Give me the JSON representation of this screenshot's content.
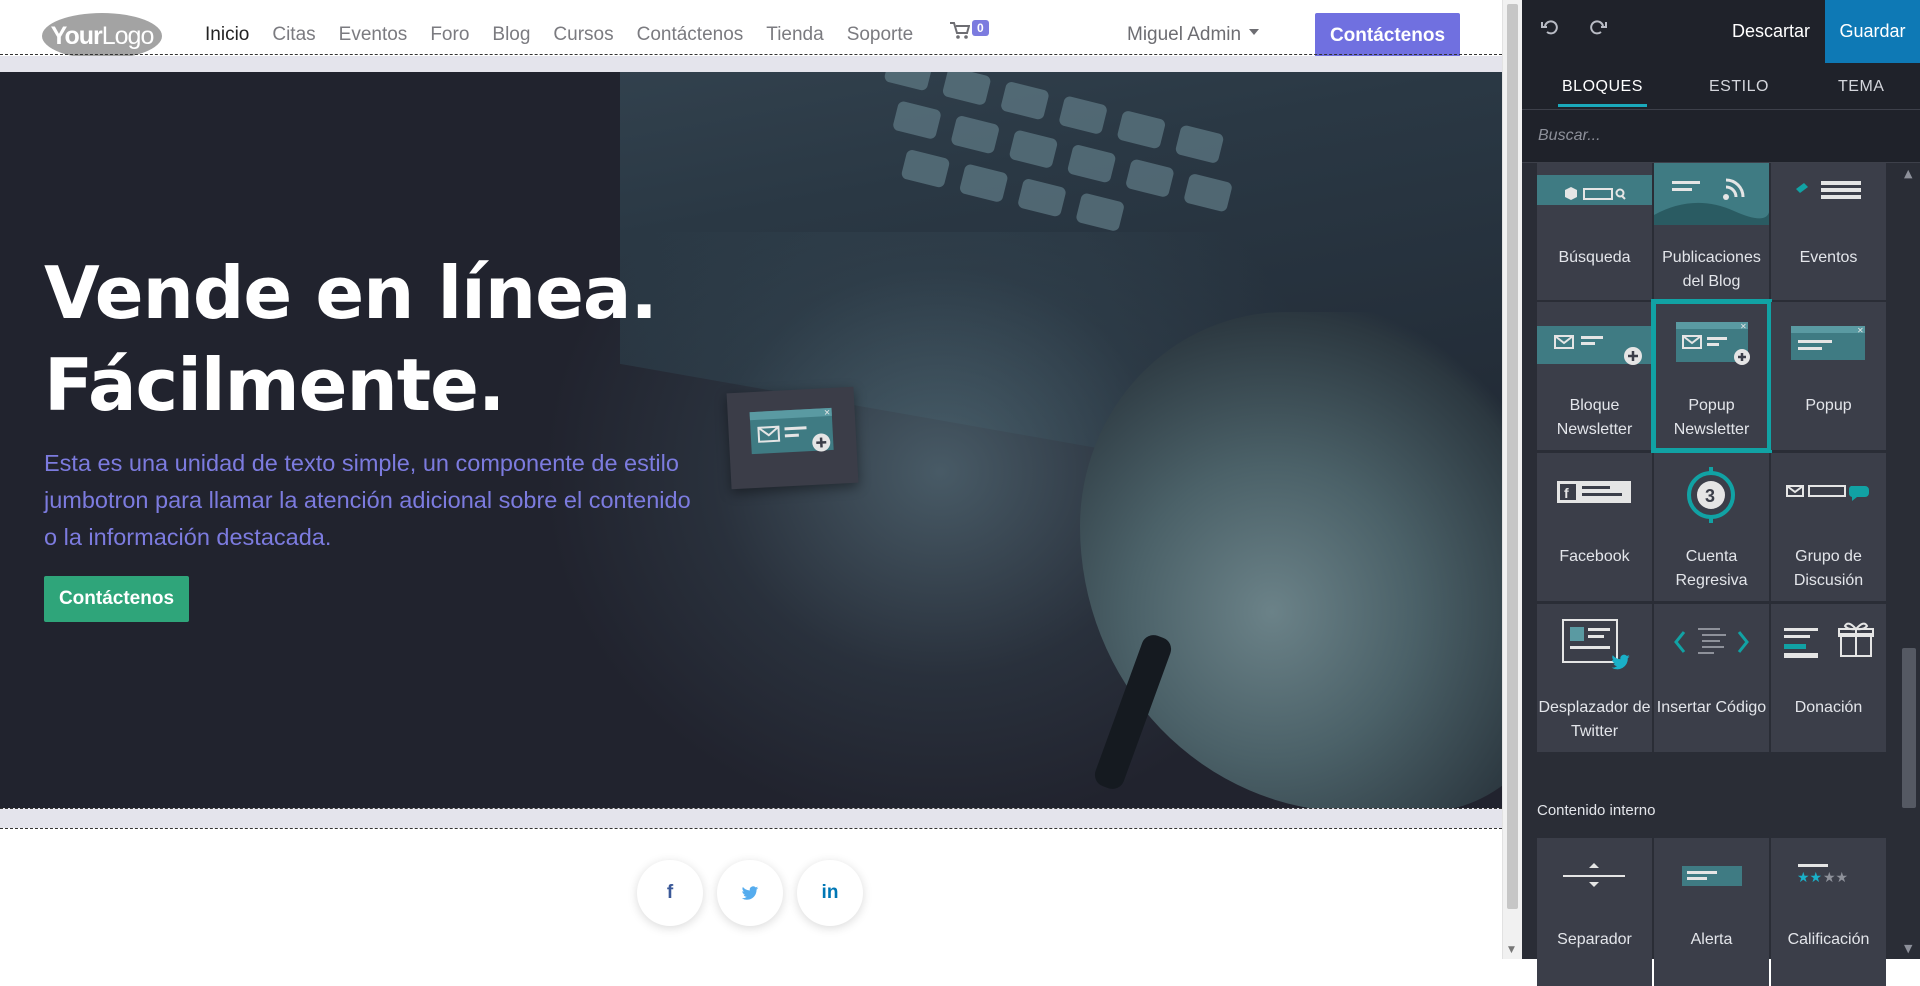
{
  "site": {
    "logo": {
      "bold": "Your",
      "light": "Logo"
    },
    "menu": [
      "Inicio",
      "Citas",
      "Eventos",
      "Foro",
      "Blog",
      "Cursos",
      "Contáctenos",
      "Tienda",
      "Soporte"
    ],
    "cart_count": "0",
    "user": "Miguel Admin",
    "nav_cta": "Contáctenos",
    "hero": {
      "title_line1": "Vende en línea.",
      "title_line2": "Fácilmente.",
      "subtitle": "Esta es una unidad de texto simple, un componente de estilo jumbotron para llamar la atención adicional sobre el contenido o la información destacada.",
      "button": "Contáctenos"
    },
    "social": [
      {
        "icon": "facebook-icon",
        "glyph": "f",
        "color": "#3b5998"
      },
      {
        "icon": "twitter-icon",
        "glyph": "🐦",
        "color": "#55acee"
      },
      {
        "icon": "linkedin-icon",
        "glyph": "in",
        "color": "#0077b5"
      }
    ]
  },
  "panel": {
    "discard": "Descartar",
    "save": "Guardar",
    "tabs": [
      "BLOQUES",
      "ESTILO",
      "TEMA"
    ],
    "active_tab": "BLOQUES",
    "search_placeholder": "Buscar...",
    "blocks": [
      {
        "label": "Búsqueda",
        "icon": "search-block-icon"
      },
      {
        "label": "Publicaciones del Blog",
        "icon": "blog-posts-icon"
      },
      {
        "label": "Eventos",
        "icon": "events-icon"
      },
      {
        "label": "Bloque Newsletter",
        "icon": "newsletter-block-icon"
      },
      {
        "label": "Popup Newsletter",
        "icon": "newsletter-popup-icon",
        "selected": true
      },
      {
        "label": "Popup",
        "icon": "popup-icon"
      },
      {
        "label": "Facebook",
        "icon": "facebook-block-icon"
      },
      {
        "label": "Cuenta Regresiva",
        "icon": "countdown-icon",
        "countdown_number": "3"
      },
      {
        "label": "Grupo de Discusión",
        "icon": "discussion-group-icon"
      },
      {
        "label": "Desplazador de Twitter",
        "icon": "twitter-scroller-icon"
      },
      {
        "label": "Insertar Código",
        "icon": "embed-code-icon"
      },
      {
        "label": "Donación",
        "icon": "donation-icon"
      }
    ],
    "inner_title": "Contenido interno",
    "inner_blocks": [
      {
        "label": "Separador",
        "icon": "separator-icon"
      },
      {
        "label": "Alerta",
        "icon": "alert-icon"
      },
      {
        "label": "Calificación",
        "icon": "rating-icon"
      }
    ]
  },
  "colors": {
    "accent": "#7070e0",
    "success": "#2fa57a",
    "teal": "#11a2a4",
    "save": "#0e79b5"
  }
}
